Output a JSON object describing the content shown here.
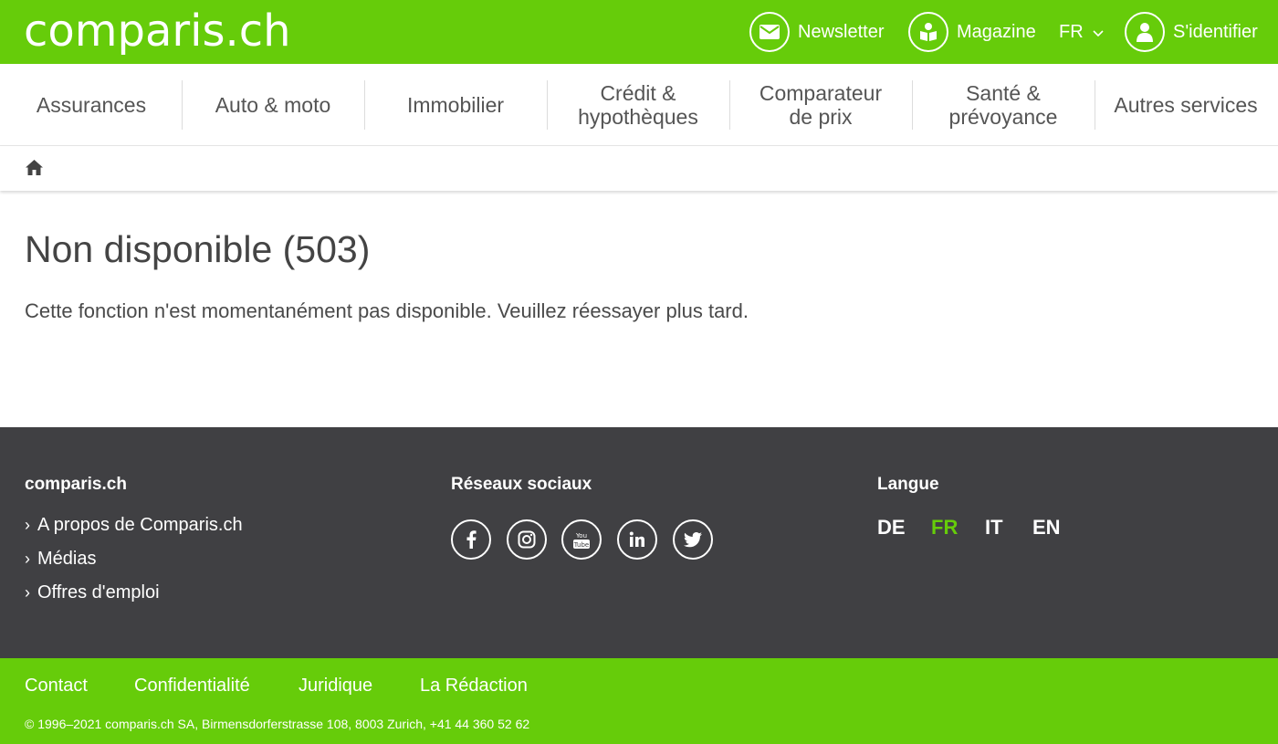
{
  "header": {
    "logo": "comparis.ch",
    "newsletter": "Newsletter",
    "magazine": "Magazine",
    "language": "FR",
    "login": "S'identifier"
  },
  "nav": {
    "items": [
      {
        "line1": "Assurances",
        "line2": ""
      },
      {
        "line1": "Auto & moto",
        "line2": ""
      },
      {
        "line1": "Immobilier",
        "line2": ""
      },
      {
        "line1": "Crédit &",
        "line2": "hypothèques"
      },
      {
        "line1": "Comparateur",
        "line2": "de prix"
      },
      {
        "line1": "Santé &",
        "line2": "prévoyance"
      },
      {
        "line1": "Autres services",
        "line2": ""
      }
    ]
  },
  "main": {
    "title": "Non disponible (503)",
    "message": "Cette fonction n'est momentanément pas disponible. Veuillez réessayer plus tard."
  },
  "footer": {
    "col1_title": "comparis.ch",
    "links": [
      "A propos de Comparis.ch",
      "Médias",
      "Offres d'emploi"
    ],
    "col2_title": "Réseaux sociaux",
    "social_icons": [
      "facebook-icon",
      "instagram-icon",
      "youtube-icon",
      "linkedin-icon",
      "twitter-icon"
    ],
    "col3_title": "Langue",
    "languages": [
      "DE",
      "FR",
      "IT",
      "EN"
    ],
    "active_language": "FR"
  },
  "subfooter": {
    "links": [
      "Contact",
      "Confidentialité",
      "Juridique",
      "La Rédaction"
    ],
    "copyright": "© 1996–2021 comparis.ch SA, Birmensdorferstrasse 108, 8003 Zurich, +41 44 360 52 62"
  },
  "colors": {
    "brand_green": "#66cc0a",
    "footer_dark": "#404043",
    "text": "#444444"
  }
}
